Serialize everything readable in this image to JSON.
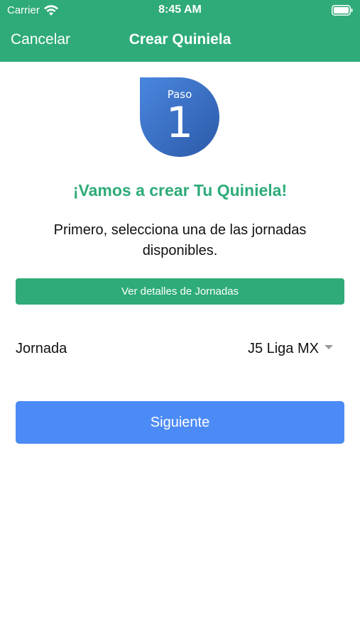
{
  "status_bar": {
    "carrier": "Carrier",
    "time": "8:45 AM",
    "wifi_icon": "wifi-icon",
    "battery_icon": "battery-icon"
  },
  "nav": {
    "cancel_label": "Cancelar",
    "title": "Crear Quiniela"
  },
  "step": {
    "label": "Paso",
    "number": "1"
  },
  "headline": "¡Vamos a crear Tu Quiniela!",
  "subtext": "Primero, selecciona una de las jornadas disponibles.",
  "details_button_label": "Ver detalles de Jornadas",
  "jornada": {
    "label": "Jornada",
    "selected_value": "J5 Liga MX"
  },
  "next_button_label": "Siguiente",
  "colors": {
    "brand_green": "#2eab78",
    "primary_blue": "#4c8bf5",
    "badge_blue_light": "#3f78d6",
    "badge_blue_dark": "#2f5fb3"
  }
}
